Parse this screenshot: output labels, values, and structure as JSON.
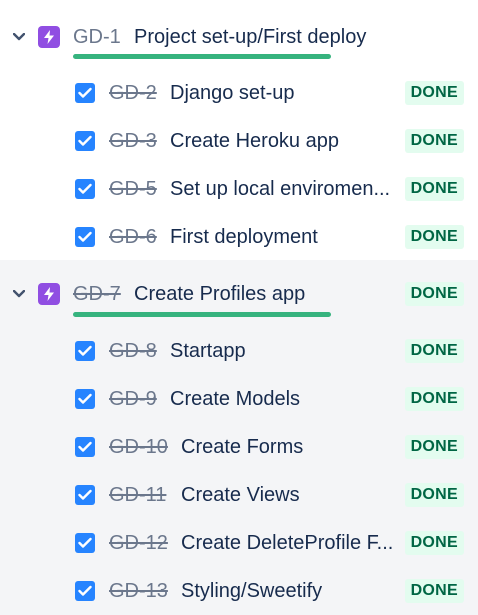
{
  "epics": [
    {
      "key": "GD-1",
      "title": "Project set-up/First deploy",
      "status": "",
      "tasks": [
        {
          "key": "GD-2",
          "title": "Django set-up",
          "status": "DONE"
        },
        {
          "key": "GD-3",
          "title": "Create Heroku app",
          "status": "DONE"
        },
        {
          "key": "GD-5",
          "title": "Set up local enviromen...",
          "status": "DONE"
        },
        {
          "key": "GD-6",
          "title": "First deployment",
          "status": "DONE"
        }
      ]
    },
    {
      "key": "GD-7",
      "title": "Create Profiles app",
      "status": "DONE",
      "tasks": [
        {
          "key": "GD-8",
          "title": "Startapp",
          "status": "DONE"
        },
        {
          "key": "GD-9",
          "title": "Create Models",
          "status": "DONE"
        },
        {
          "key": "GD-10",
          "title": "Create Forms",
          "status": "DONE"
        },
        {
          "key": "GD-11",
          "title": "Create Views",
          "status": "DONE"
        },
        {
          "key": "GD-12",
          "title": "Create DeleteProfile F...",
          "status": "DONE"
        },
        {
          "key": "GD-13",
          "title": "Styling/Sweetify",
          "status": "DONE"
        }
      ]
    }
  ],
  "icons": {
    "chevron": "chevron-down-icon",
    "epic": "lightning-bolt-icon",
    "checkbox": "checkmark-icon"
  },
  "colors": {
    "epic_icon": "#904ee2",
    "checkbox": "#2684ff",
    "progress": "#36b37e",
    "done_bg": "#e3fcef",
    "done_text": "#006644"
  }
}
